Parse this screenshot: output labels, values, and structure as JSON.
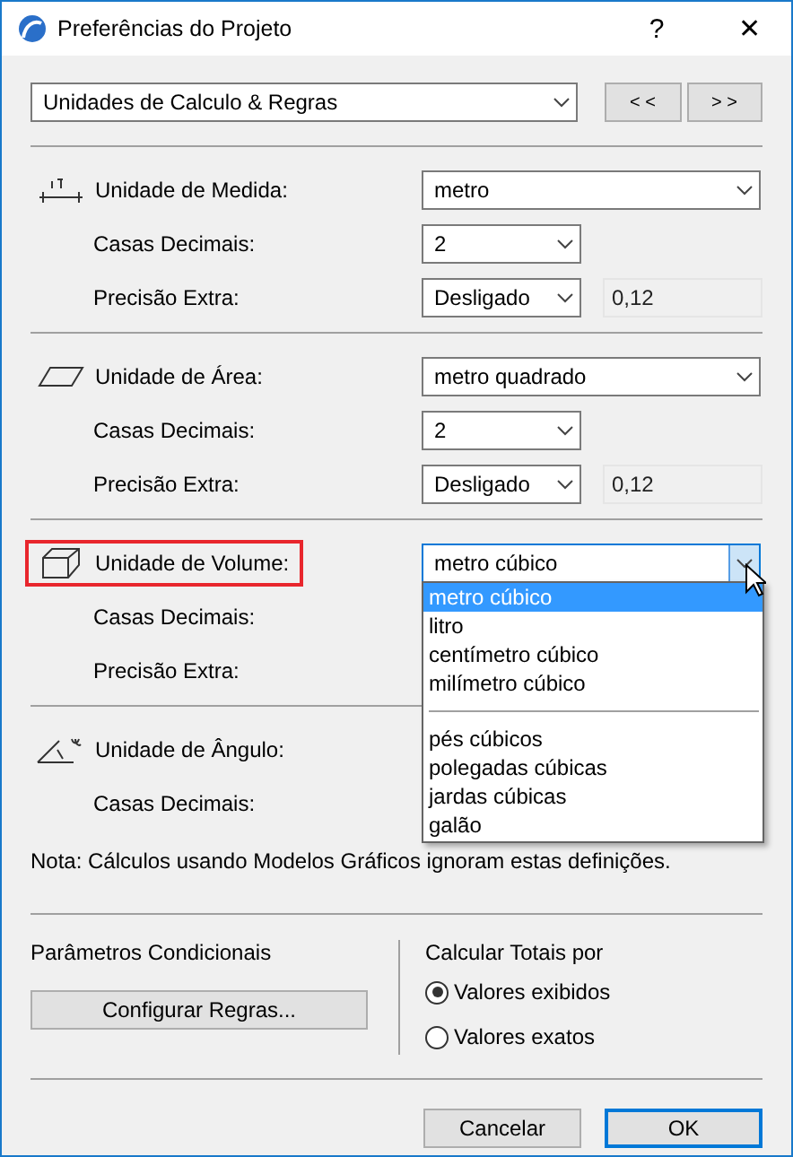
{
  "window": {
    "title": "Preferências do Projeto",
    "help": "?",
    "close": "✕"
  },
  "page_select": {
    "value": "Unidades de Calculo & Regras"
  },
  "nav_buttons": [
    "< <",
    "> >"
  ],
  "sections": [
    {
      "label": "Unidade de Medida:",
      "highlighted": false,
      "rows": [
        {
          "kind": "unit",
          "value": "metro"
        },
        {
          "kind": "decimals",
          "label": "Casas Decimais:",
          "value": "2"
        },
        {
          "kind": "precision",
          "label": "Precisão Extra:",
          "value": "Desligado",
          "sample": "0,12"
        }
      ]
    },
    {
      "label": "Unidade de Área:",
      "highlighted": false,
      "rows": [
        {
          "kind": "unit",
          "value": "metro quadrado"
        },
        {
          "kind": "decimals",
          "label": "Casas Decimais:",
          "value": "2"
        },
        {
          "kind": "precision",
          "label": "Precisão Extra:",
          "value": "Desligado",
          "sample": "0,12"
        }
      ]
    },
    {
      "label": "Unidade de Volume:",
      "highlighted": true,
      "rows": [
        {
          "kind": "unit",
          "value": "metro cúbico",
          "expanded": true,
          "options": [
            {
              "kind": "option",
              "label": "metro cúbico",
              "selected": true
            },
            {
              "kind": "option",
              "label": "litro",
              "selected": false
            },
            {
              "kind": "option",
              "label": "centímetro cúbico",
              "selected": false
            },
            {
              "kind": "option",
              "label": "milímetro cúbico",
              "selected": false
            },
            {
              "kind": "separator"
            },
            {
              "kind": "option",
              "label": "pés cúbicos",
              "selected": false
            },
            {
              "kind": "option",
              "label": "polegadas cúbicas",
              "selected": false
            },
            {
              "kind": "option",
              "label": "jardas cúbicas",
              "selected": false
            },
            {
              "kind": "option",
              "label": "galão",
              "selected": false
            }
          ]
        },
        {
          "kind": "hidden",
          "label": "Casas Decimais:"
        },
        {
          "kind": "hidden",
          "label": "Precisão Extra:"
        }
      ]
    },
    {
      "label": "Unidade de Ângulo:",
      "highlighted": false,
      "rows": [
        {
          "kind": "hidden"
        },
        {
          "kind": "hidden",
          "label": "Casas Decimais:"
        }
      ]
    }
  ],
  "note": "Nota: Cálculos usando Modelos Gráficos ignoram estas definições.",
  "conditional": {
    "title": "Parâmetros Condicionais",
    "button": "Configurar Regras..."
  },
  "totals": {
    "title": "Calcular Totais por",
    "options": [
      {
        "label": "Valores exibidos",
        "selected": true
      },
      {
        "label": "Valores exatos",
        "selected": false
      }
    ]
  },
  "buttons": [
    {
      "label": "Cancelar",
      "default": false
    },
    {
      "label": "OK",
      "default": true
    }
  ]
}
